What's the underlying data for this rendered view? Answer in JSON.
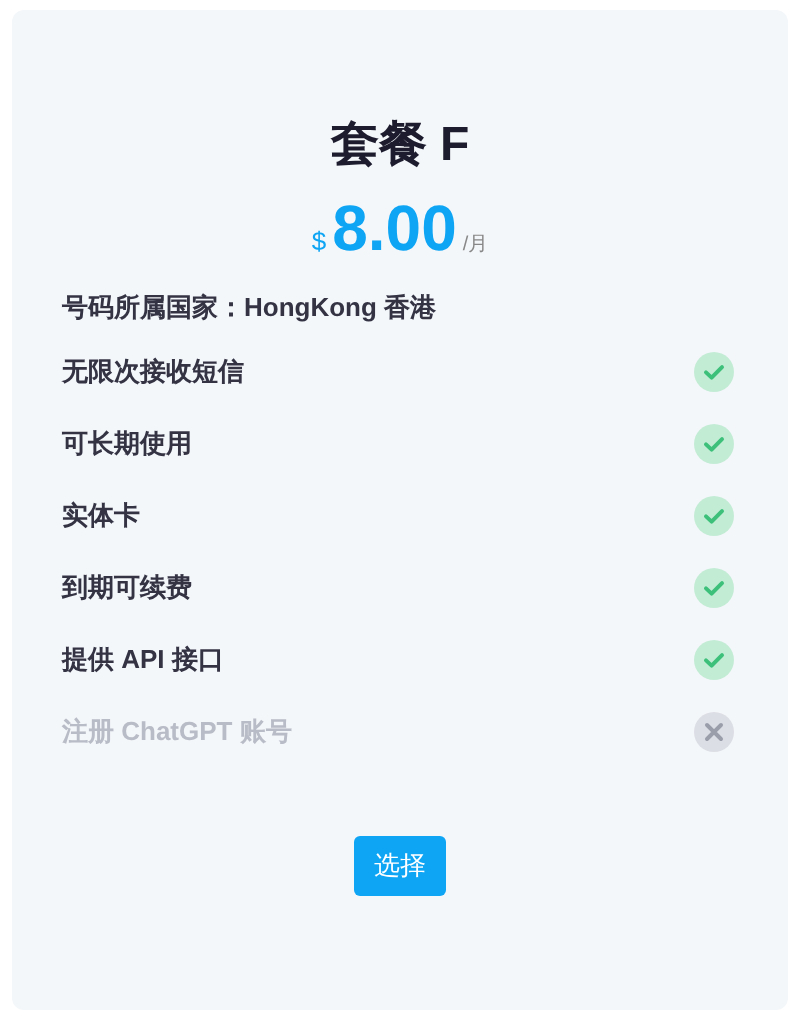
{
  "plan": {
    "title": "套餐 F",
    "currency": "$",
    "price": "8.00",
    "period": "/月",
    "country": "号码所属国家：HongKong 香港",
    "features": [
      {
        "label": "无限次接收短信",
        "included": true
      },
      {
        "label": "可长期使用",
        "included": true
      },
      {
        "label": "实体卡",
        "included": true
      },
      {
        "label": "到期可续费",
        "included": true
      },
      {
        "label": "提供 API 接口",
        "included": true
      },
      {
        "label": "注册 ChatGPT 账号",
        "included": false
      }
    ],
    "button": "选择"
  }
}
